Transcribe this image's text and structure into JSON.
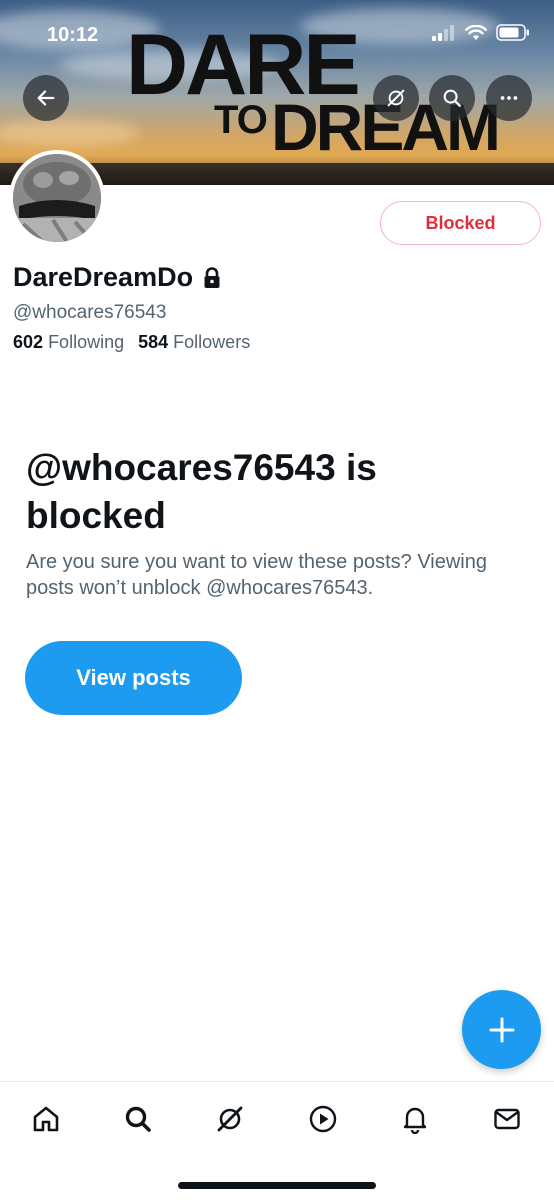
{
  "status_bar": {
    "time": "10:12"
  },
  "banner": {
    "line1": "DARE",
    "line2_small": "TO",
    "line2_large": "DREAM"
  },
  "profile": {
    "display_name": "DareDreamDo",
    "handle": "@whocares76543",
    "following_count": "602",
    "following_label": "Following",
    "followers_count": "584",
    "followers_label": "Followers",
    "blocked_button_label": "Blocked"
  },
  "blocked_notice": {
    "title": "@whocares76543 is blocked",
    "description": "Are you sure you want to view these posts? Viewing posts won’t unblock @whocares76543.",
    "view_posts_label": "View posts"
  },
  "colors": {
    "accent": "#1d9bf0",
    "blocked_red": "#e52d3b",
    "secondary_text": "#536471"
  },
  "icons": [
    "back-arrow-icon",
    "grok-icon",
    "search-icon",
    "more-icon",
    "lock-icon",
    "plus-icon",
    "home-icon",
    "explore-icon",
    "grok-tab-icon",
    "video-icon",
    "notifications-icon",
    "messages-icon"
  ]
}
